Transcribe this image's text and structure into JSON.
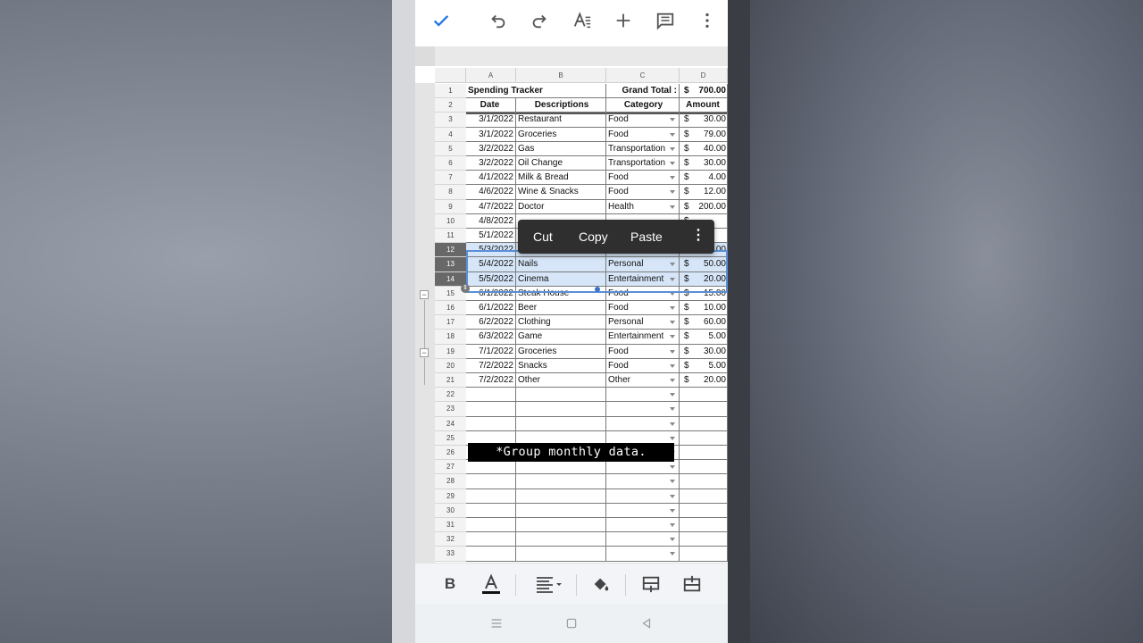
{
  "toolbar": {
    "done_icon": "check-icon",
    "undo_icon": "undo-icon",
    "redo_icon": "redo-icon",
    "format_icon": "text-format-icon",
    "insert_icon": "plus-icon",
    "comment_icon": "comment-icon",
    "more_icon": "more-vert-icon",
    "accent": "#1a73e8"
  },
  "columns": [
    "A",
    "B",
    "C",
    "D"
  ],
  "sheet": {
    "title": "Spending Tracker",
    "grand_total_label": "Grand Total :",
    "grand_total_currency": "$",
    "grand_total_value": "700.00",
    "headers": {
      "date": "Date",
      "descriptions": "Descriptions",
      "category": "Category",
      "amount": "Amount"
    },
    "row_numbers": [
      "1",
      "2",
      "3",
      "4",
      "5",
      "6",
      "7",
      "8",
      "9",
      "10",
      "11",
      "12",
      "13",
      "14",
      "15",
      "16",
      "17",
      "18",
      "19",
      "20",
      "21",
      "22",
      "23",
      "24",
      "25",
      "26",
      "27",
      "28",
      "29",
      "30",
      "31",
      "32",
      "33"
    ],
    "rows": [
      {
        "date": "3/1/2022",
        "desc": "Restaurant",
        "category": "Food",
        "currency": "$",
        "amount": "30.00"
      },
      {
        "date": "3/1/2022",
        "desc": "Groceries",
        "category": "Food",
        "currency": "$",
        "amount": "79.00"
      },
      {
        "date": "3/2/2022",
        "desc": "Gas",
        "category": "Transportation",
        "currency": "$",
        "amount": "40.00"
      },
      {
        "date": "3/2/2022",
        "desc": "Oil Change",
        "category": "Transportation",
        "currency": "$",
        "amount": "30.00"
      },
      {
        "date": "4/1/2022",
        "desc": "Milk & Bread",
        "category": "Food",
        "currency": "$",
        "amount": "4.00"
      },
      {
        "date": "4/6/2022",
        "desc": "Wine & Snacks",
        "category": "Food",
        "currency": "$",
        "amount": "12.00"
      },
      {
        "date": "4/7/2022",
        "desc": "Doctor",
        "category": "Health",
        "currency": "$",
        "amount": "200.00"
      },
      {
        "date": "4/8/2022",
        "desc": "",
        "category": "",
        "currency": "$",
        "amount": ""
      },
      {
        "date": "5/1/2022",
        "desc": "",
        "category": "",
        "currency": "$",
        "amount": ""
      },
      {
        "date": "5/3/2022",
        "desc": "Gas",
        "category": "Transportation",
        "currency": "$",
        "amount": "20.00"
      },
      {
        "date": "5/4/2022",
        "desc": "Nails",
        "category": "Personal",
        "currency": "$",
        "amount": "50.00"
      },
      {
        "date": "5/5/2022",
        "desc": "Cinema",
        "category": "Entertainment",
        "currency": "$",
        "amount": "20.00"
      },
      {
        "date": "6/1/2022",
        "desc": "Steak House",
        "category": "Food",
        "currency": "$",
        "amount": "15.00"
      },
      {
        "date": "6/1/2022",
        "desc": "Beer",
        "category": "Food",
        "currency": "$",
        "amount": "10.00"
      },
      {
        "date": "6/2/2022",
        "desc": "Clothing",
        "category": "Personal",
        "currency": "$",
        "amount": "60.00"
      },
      {
        "date": "6/3/2022",
        "desc": "Game",
        "category": "Entertainment",
        "currency": "$",
        "amount": "5.00"
      },
      {
        "date": "7/1/2022",
        "desc": "Groceries",
        "category": "Food",
        "currency": "$",
        "amount": "30.00"
      },
      {
        "date": "7/2/2022",
        "desc": "Snacks",
        "category": "Food",
        "currency": "$",
        "amount": "5.00"
      },
      {
        "date": "7/2/2022",
        "desc": "Other",
        "category": "Other",
        "currency": "$",
        "amount": "20.00"
      }
    ]
  },
  "context_menu": {
    "cut": "Cut",
    "copy": "Copy",
    "paste": "Paste",
    "more": "⋮"
  },
  "caption": "*Group monthly data.",
  "format_bar": {
    "bold": "B",
    "text_color_icon": "text-color-icon",
    "align_icon": "align-icon",
    "fill_icon": "fill-color-icon",
    "insert_row_icon": "insert-row-icon",
    "insert_col_icon": "insert-column-icon"
  },
  "navbar": {
    "recent_icon": "recent-apps-icon",
    "home_icon": "home-icon",
    "back_icon": "back-icon"
  }
}
